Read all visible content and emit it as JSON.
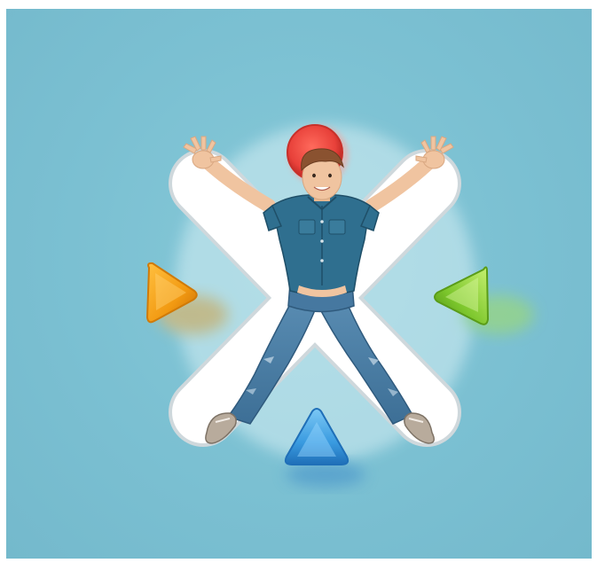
{
  "scene": {
    "background_color": "#7bc0d2",
    "border_color": "#ffffff",
    "subject": "jumping-child",
    "shapes": [
      {
        "shape": "circle",
        "color": "#e8413a"
      },
      {
        "shape": "cross",
        "color": "#ffffff"
      },
      {
        "shape": "triangle-right",
        "color": "#f29a12"
      },
      {
        "shape": "triangle-left",
        "color": "#7cc62c"
      },
      {
        "shape": "triangle-up",
        "color": "#3a9be0"
      }
    ],
    "outfit_colors": {
      "shirt": "#2f6f8f",
      "jeans": "#3d6f96",
      "hair": "#8a5230",
      "skin": "#f0c4a0",
      "shoes": "#b8ab9c"
    }
  }
}
